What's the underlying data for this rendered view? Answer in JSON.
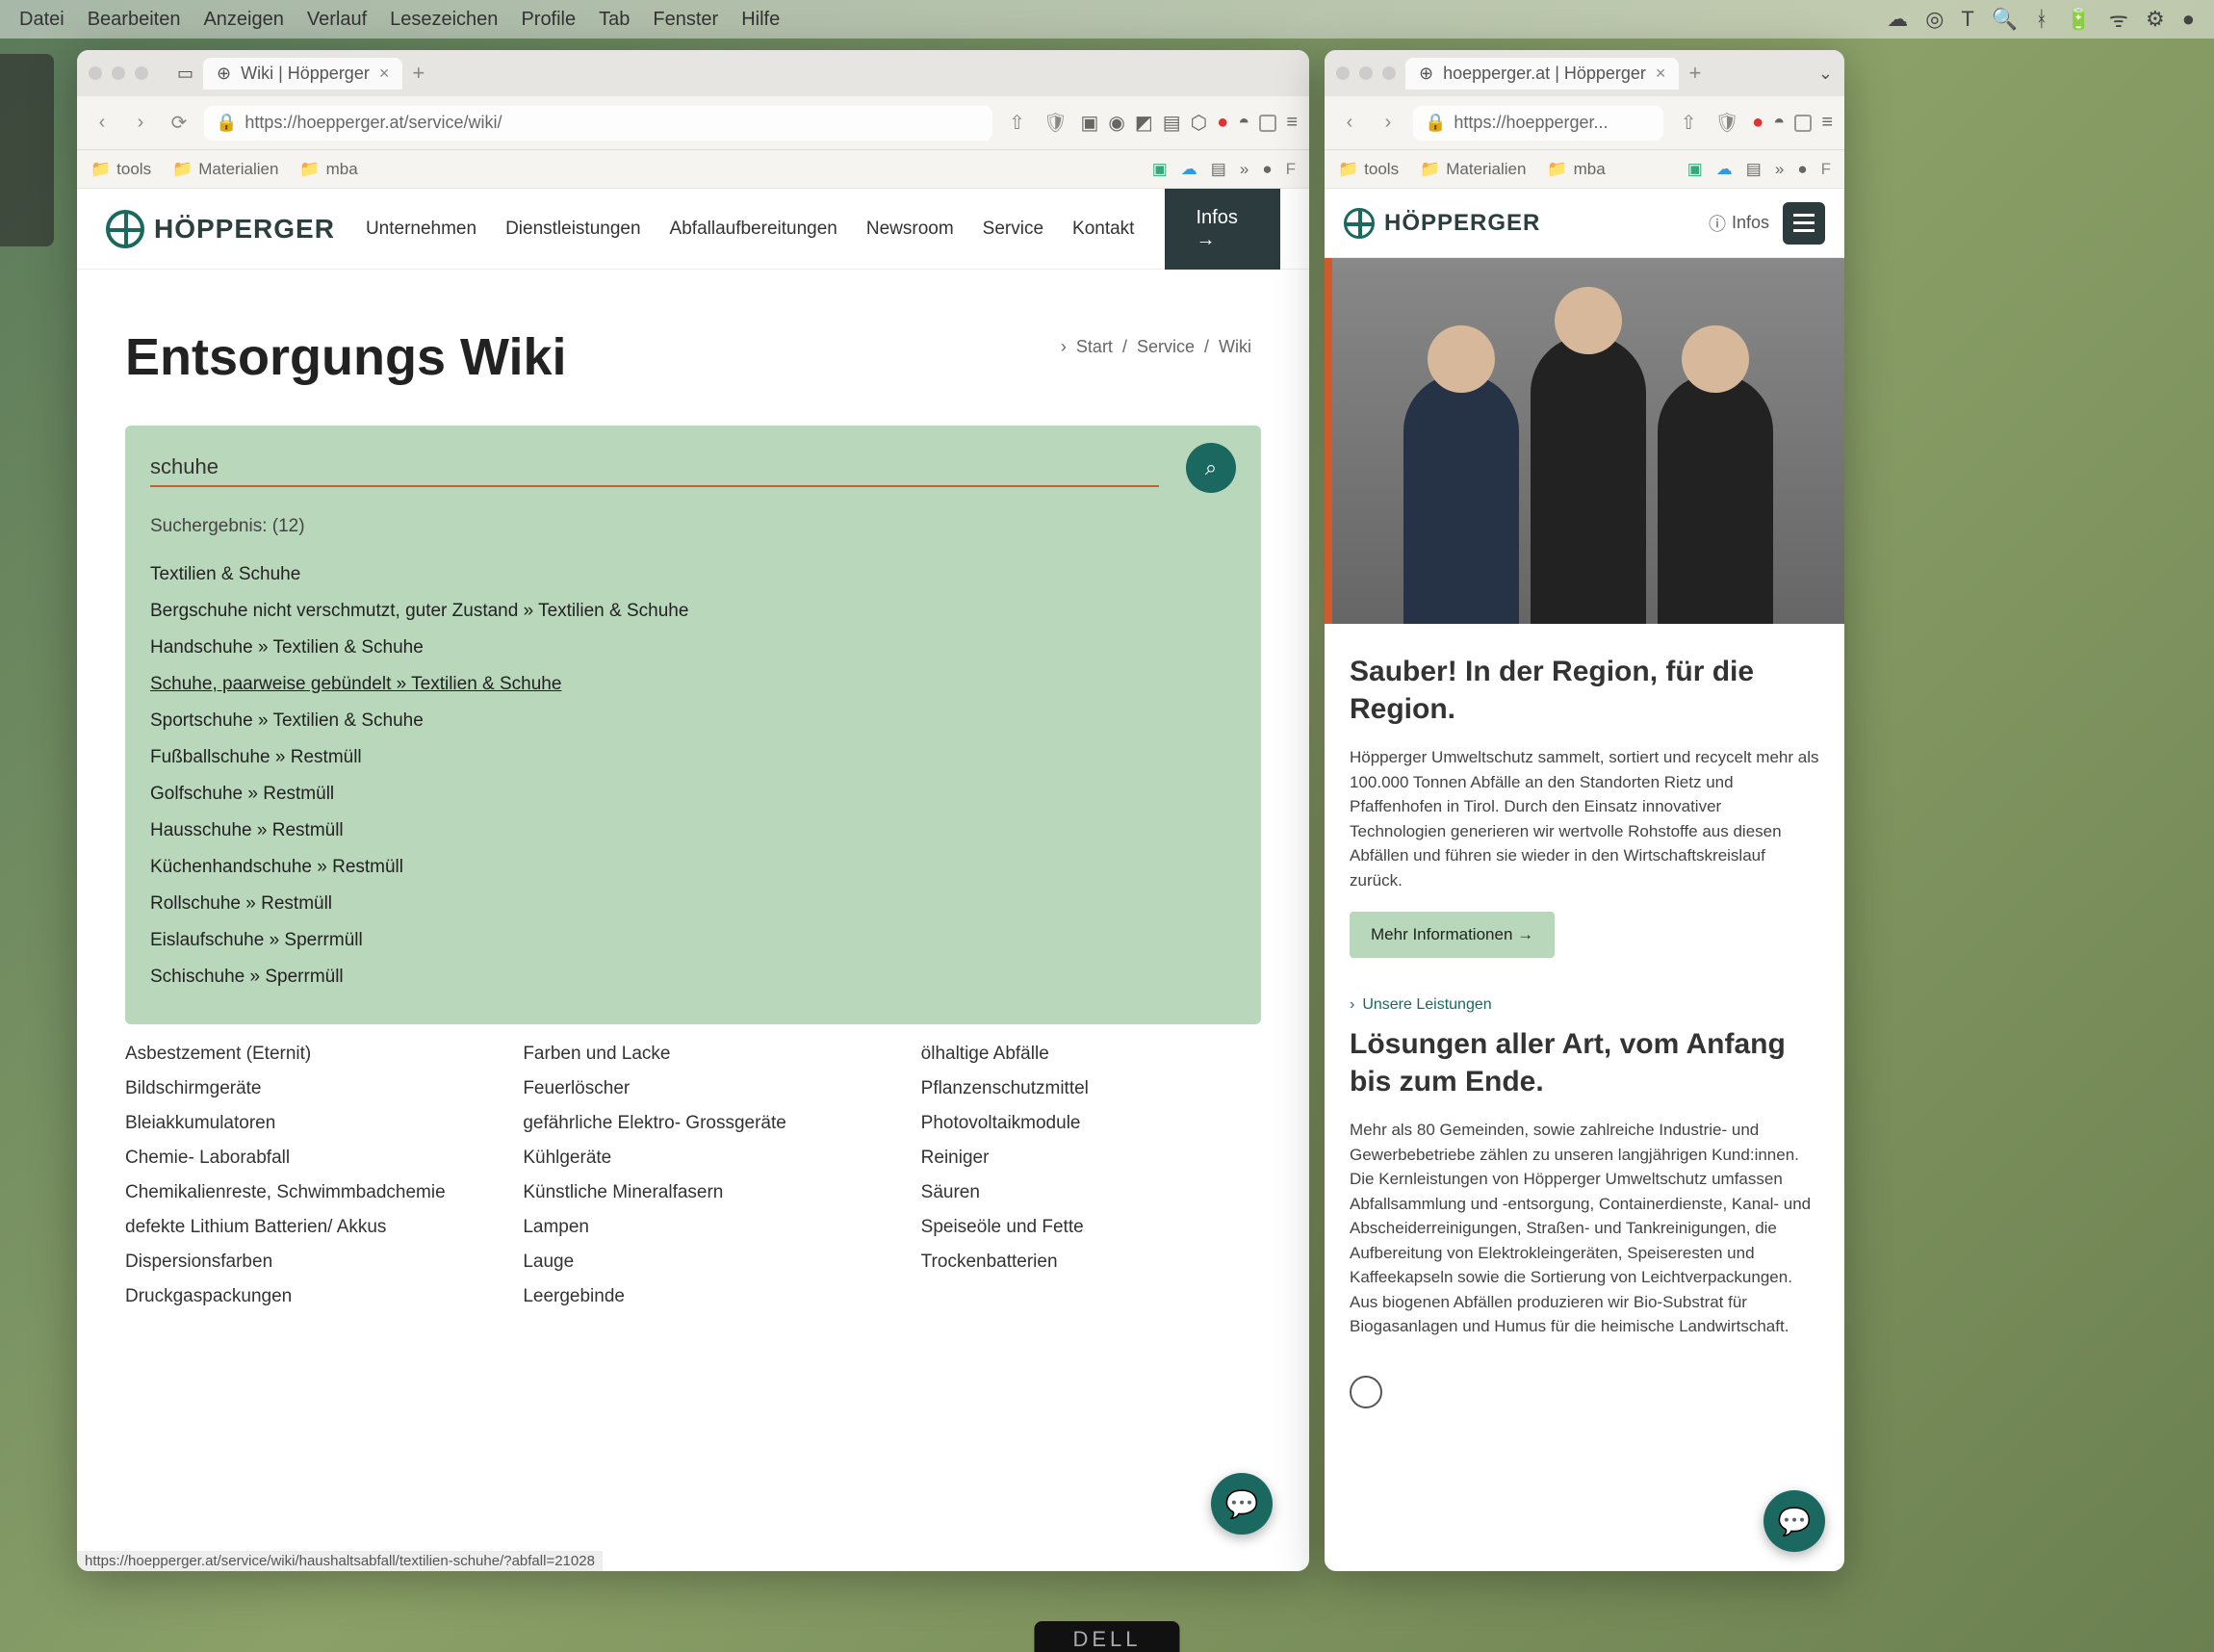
{
  "macos_menu": [
    "Datei",
    "Bearbeiten",
    "Anzeigen",
    "Verlauf",
    "Lesezeichen",
    "Profile",
    "Tab",
    "Fenster",
    "Hilfe"
  ],
  "browser_left": {
    "tab_title": "Wiki | Höpperger",
    "url": "https://hoepperger.at/service/wiki/",
    "bookmarks": [
      "tools",
      "Materialien",
      "mba"
    ],
    "site": {
      "brand": "HÖPPERGER",
      "nav": [
        "Unternehmen",
        "Dienstleistungen",
        "Abfallaufbereitungen",
        "Newsroom",
        "Service",
        "Kontakt"
      ],
      "infos": "Infos →"
    },
    "page": {
      "title": "Entsorgungs Wiki",
      "breadcrumb": [
        "Start",
        "Service",
        "Wiki"
      ],
      "search": {
        "value": "schuhe",
        "result_label": "Suchergebnis: (12)",
        "results": [
          "Textilien & Schuhe",
          "Bergschuhe nicht verschmutzt, guter Zustand » Textilien & Schuhe",
          "Handschuhe » Textilien & Schuhe",
          "Schuhe, paarweise gebündelt » Textilien & Schuhe",
          "Sportschuhe » Textilien & Schuhe",
          "Fußballschuhe » Restmüll",
          "Golfschuhe » Restmüll",
          "Hausschuhe » Restmüll",
          "Küchenhandschuhe » Restmüll",
          "Rollschuhe » Restmüll",
          "Eislaufschuhe » Sperrmüll",
          "Schischuhe » Sperrmüll"
        ]
      },
      "columns": {
        "col1": [
          "Asbestzement (Eternit)",
          "Bildschirmgeräte",
          "Bleiakkumulatoren",
          "Chemie- Laborabfall",
          "Chemikalienreste, Schwimmbadchemie",
          "defekte Lithium Batterien/ Akkus",
          "Dispersionsfarben",
          "Druckgaspackungen"
        ],
        "col2": [
          "Farben und Lacke",
          "Feuerlöscher",
          "gefährliche Elektro- Grossgeräte",
          "Kühlgeräte",
          "Künstliche Mineralfasern",
          "Lampen",
          "Lauge",
          "Leergebinde"
        ],
        "col3": [
          "ölhaltige Abfälle",
          "Pflanzenschutzmittel",
          "Photovoltaikmodule",
          "Reiniger",
          "Säuren",
          "Speiseöle und Fette",
          "Trockenbatterien"
        ]
      },
      "status_url": "https://hoepperger.at/service/wiki/haushaltsabfall/textilien-schuhe/?abfall=21028"
    }
  },
  "browser_right": {
    "tab_title": "hoepperger.at | Höpperger",
    "url": "https://hoepperger...",
    "bookmarks": [
      "tools",
      "Materialien",
      "mba"
    ],
    "site": {
      "brand": "HÖPPERGER",
      "infos": "Infos"
    },
    "hero": {
      "heading": "Sauber! In der Region, für die Region.",
      "body": "Höpperger Umweltschutz sammelt, sortiert und recycelt mehr als 100.000 Tonnen Abfälle an den Standorten Rietz und Pfaffenhofen in Tirol. Durch den Einsatz innovativer Technologien generieren wir wertvolle Rohstoffe aus diesen Abfällen und führen sie wieder in den Wirtschaftskreislauf zurück.",
      "cta": "Mehr Informationen  →"
    },
    "services": {
      "kicker": "Unsere Leistungen",
      "heading": "Lösungen aller Art, vom Anfang bis zum Ende.",
      "body": "Mehr als 80 Gemeinden, sowie zahlreiche Industrie- und Gewerbebetriebe zählen zu unseren langjährigen Kund:innen. Die Kernleistungen von Höpperger Umweltschutz umfassen Abfallsammlung und -entsorgung, Containerdienste, Kanal- und Abscheiderreinigungen, Straßen- und Tankreinigungen, die Aufbereitung von Elektrokleingeräten, Speiseresten und Kaffeekapseln sowie die Sortierung von Leichtverpackungen. Aus biogenen Abfällen produzieren wir Bio-Substrat für Biogasanlagen und Humus für die heimische Landwirtschaft."
    }
  },
  "monitor_brand": "DELL"
}
